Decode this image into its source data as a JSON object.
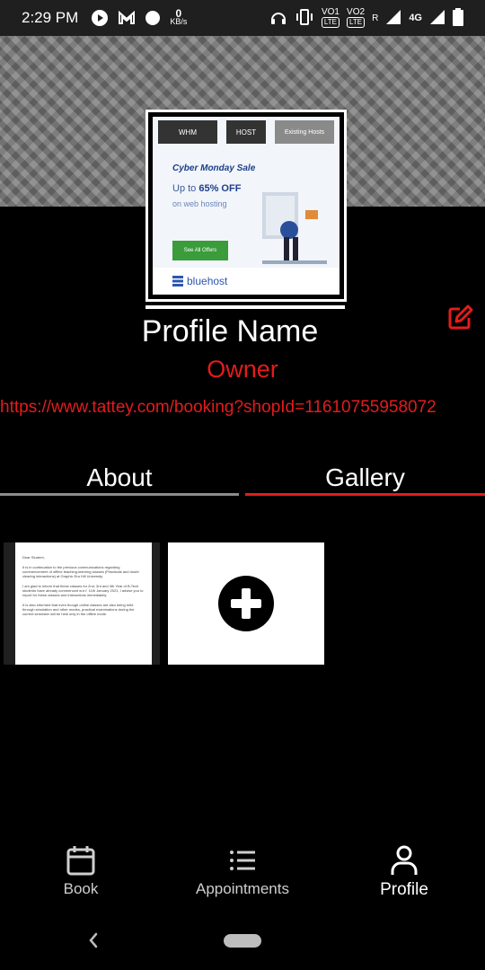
{
  "status_bar": {
    "time": "2:29 PM",
    "net_speed_value": "0",
    "net_speed_unit": "KB/s",
    "vo1": "VO1",
    "vo2": "VO2",
    "lte": "LTE",
    "roaming": "R",
    "network": "4G",
    "icons": [
      "play-circle-icon",
      "gmail-icon",
      "dot-icon",
      "headphones-icon",
      "vibrate-icon",
      "signal-icon",
      "battery-icon"
    ]
  },
  "profile": {
    "name": "Profile Name",
    "role": "Owner",
    "url": "https://www.tattey.com/booking?shopId=11610755958072"
  },
  "ad": {
    "tabs": [
      "WHM",
      "HOST",
      "Existing Hosts"
    ],
    "headline": "Cyber Monday Sale",
    "offer_prefix": "Up to",
    "offer_value": "65% OFF",
    "offer_sub": "on web hosting",
    "cta": "See All Offers",
    "brand": "bluehost"
  },
  "tabs": {
    "about": "About",
    "gallery": "Gallery",
    "active": "gallery"
  },
  "gallery": {
    "doc_lines": [
      "Dear Student,",
      "It is in continuation to the previous communications regarding commencement of offline teaching-learning classes (Practicals and doubt clearing interactions) at Graphic Era Hill University.",
      "I am glad to inform that these classes for 2nd, 3rd and 4th Year of B.Tech students have already commenced w.e.f. 11th January 2021, I advise you to report for these classes and interactions immediately.",
      "It is also informed that even though online classes are also being held through simulation and other modes, practical examinations during the current semester will be held only in the offline mode."
    ]
  },
  "bottom_nav": {
    "items": [
      {
        "label": "Book",
        "icon": "calendar-icon"
      },
      {
        "label": "Appointments",
        "icon": "list-icon"
      },
      {
        "label": "Profile",
        "icon": "person-icon"
      }
    ],
    "active": "Profile"
  },
  "colors": {
    "accent": "#e31c1c",
    "background": "#000000"
  }
}
